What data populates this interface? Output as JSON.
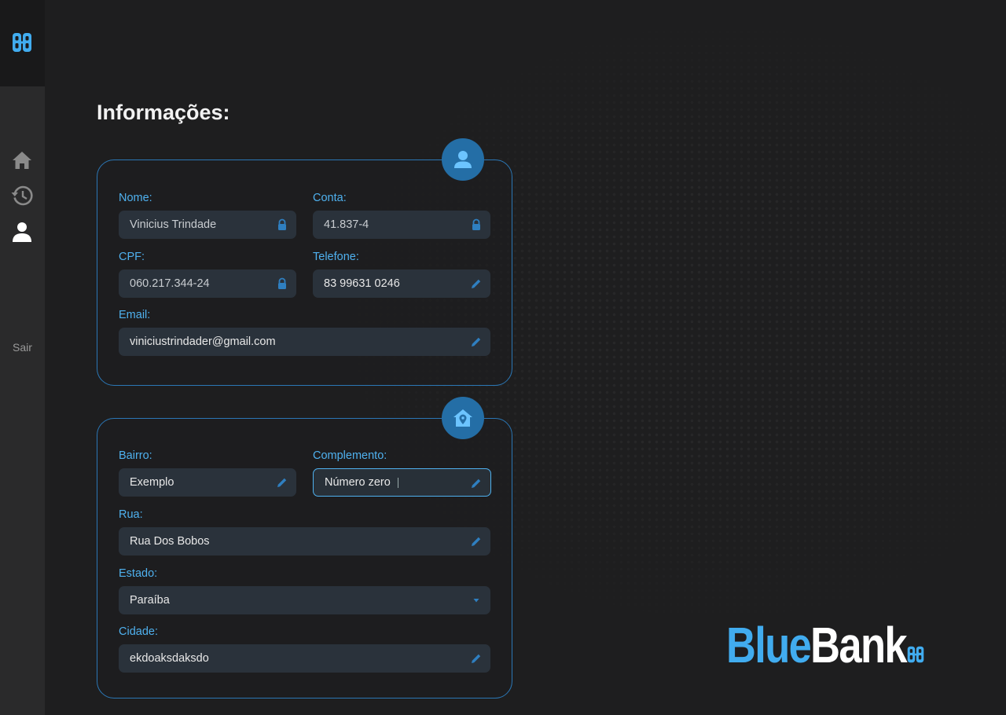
{
  "app": {
    "brand_part1": "Blue",
    "brand_part2": "Bank",
    "accent_color": "#4fb1ef",
    "logo_icon": "bluebank-logo-icon"
  },
  "sidebar": {
    "items": [
      {
        "icon": "home-icon"
      },
      {
        "icon": "history-icon"
      },
      {
        "icon": "user-icon"
      }
    ],
    "logout_label": "Sair"
  },
  "page": {
    "title": "Informações:"
  },
  "personal": {
    "badge_icon": "user-icon",
    "name_label": "Nome:",
    "name_value": "Vinicius Trindade",
    "account_label": "Conta:",
    "account_value": "41.837-4",
    "cpf_label": "CPF:",
    "cpf_value": "060.217.344-24",
    "phone_label": "Telefone:",
    "phone_value": "83 99631 0246",
    "email_label": "Email:",
    "email_value": "viniciustrindader@gmail.com"
  },
  "address": {
    "badge_icon": "house-location-icon",
    "neighborhood_label": "Bairro:",
    "neighborhood_value": "Exemplo",
    "complement_label": "Complemento:",
    "complement_value": "Número zero",
    "street_label": "Rua:",
    "street_value": "Rua Dos Bobos",
    "state_label": "Estado:",
    "state_value": "Paraíba",
    "city_label": "Cidade:",
    "city_value": "ekdoaksdaksdo"
  }
}
